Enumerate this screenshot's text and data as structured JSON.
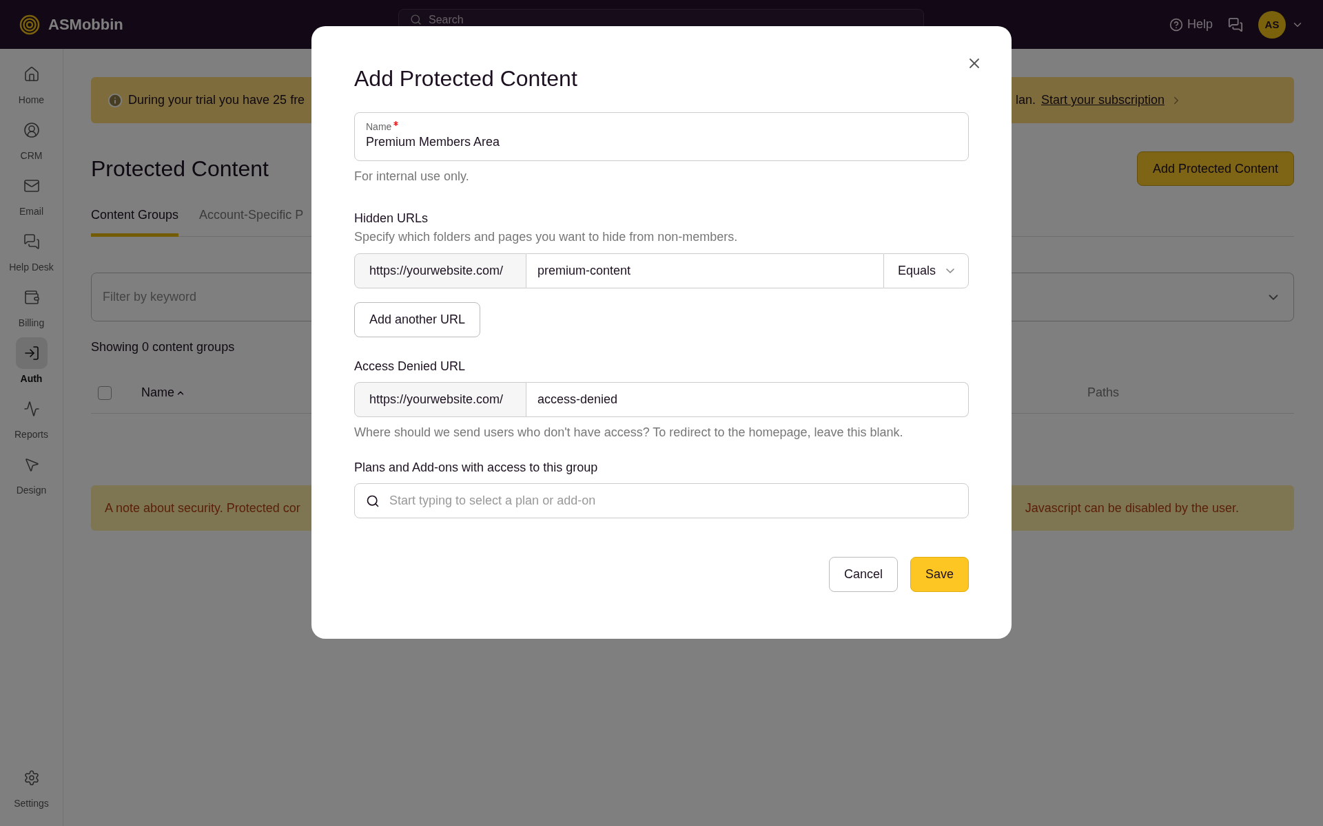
{
  "topbar": {
    "brand": "ASMobbin",
    "search": {
      "placeholder": "Search"
    },
    "help": "Help",
    "user": {
      "initials": "AS"
    }
  },
  "sidebar": {
    "items": [
      {
        "label": "Home",
        "selected": false
      },
      {
        "label": "CRM",
        "selected": false
      },
      {
        "label": "Email",
        "selected": false
      },
      {
        "label": "Help Desk",
        "selected": false
      },
      {
        "label": "Billing",
        "selected": false
      },
      {
        "label": "Auth",
        "selected": true
      },
      {
        "label": "Reports",
        "selected": false
      },
      {
        "label": "Design",
        "selected": false
      }
    ],
    "footer": {
      "label": "Settings"
    }
  },
  "banner": {
    "text_start": "During your trial you have 25 fre",
    "text_end": "lan.",
    "link": "Start your subscription"
  },
  "page": {
    "title": "Protected Content",
    "primary_button": "Add Protected Content",
    "tabs": [
      {
        "label": "Content Groups",
        "selected": true
      },
      {
        "label": "Account-Specific P",
        "selected": false
      }
    ],
    "filter": {
      "placeholder": "Filter by keyword"
    },
    "count": "Showing 0 content groups",
    "table": {
      "select_all": {
        "checked": false
      },
      "columns": [
        {
          "label": "Name",
          "sorted": true
        },
        {
          "label": "Paths",
          "sorted": false
        }
      ]
    }
  },
  "notice": {
    "text_start": "A note about security. Protected cor",
    "text_end": "Javascript can be disabled by the user."
  },
  "dialog": {
    "title": "Add Protected Content",
    "name_field": {
      "label": "Name",
      "required": true,
      "value": "Premium Members Area",
      "help": "For internal use only."
    },
    "hidden_urls": {
      "label": "Hidden URLs",
      "description": "Specify which folders and pages you want to hide from non-members.",
      "prefix": "https://yourwebsite.com/",
      "value": "premium-content",
      "match": "Equals",
      "add_button": "Add another URL"
    },
    "denied_url": {
      "label": "Access Denied URL",
      "prefix": "https://yourwebsite.com/",
      "value": "access-denied",
      "help": "Where should we send users who don't have access? To redirect to the homepage, leave this blank."
    },
    "plans": {
      "label": "Plans and Add-ons with access to this group",
      "placeholder": "Start typing to select a plan or add-on"
    },
    "buttons": [
      {
        "label": "Cancel",
        "kind": "secondary"
      },
      {
        "label": "Save",
        "kind": "primary"
      }
    ]
  }
}
